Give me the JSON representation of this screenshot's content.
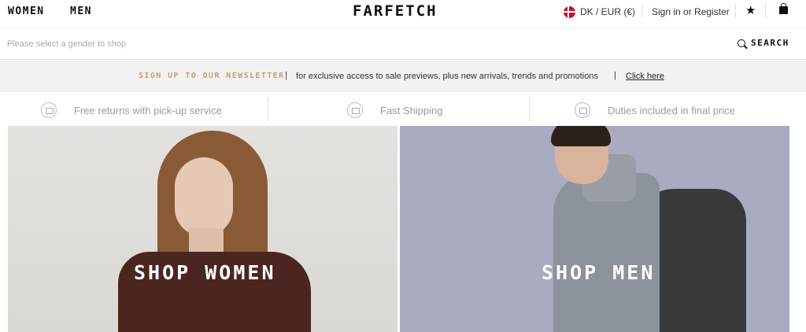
{
  "nav": {
    "women": "WOMEN",
    "men": "MEN",
    "logo": "FARFETCH",
    "locale": "DK / EUR (€)",
    "signin": "Sign in or Register",
    "wishlist_icon": "star-icon",
    "bag_icon": "bag-icon"
  },
  "search": {
    "placeholder": "Please select a gender to shop",
    "button": "SEARCH"
  },
  "newsletter": {
    "label": "SIGN UP TO OUR NEWSLETTER",
    "sep": "|",
    "text": "for exclusive access to sale previews, plus new arrivals, trends and promotions",
    "link": "Click here",
    "accent_color": "#c9a06d"
  },
  "features": [
    {
      "label": "Free returns with pick-up service",
      "icon": "return-icon"
    },
    {
      "label": "Fast Shipping",
      "icon": "shipping-icon"
    },
    {
      "label": "Duties included in final price",
      "icon": "card-icon"
    }
  ],
  "hero": {
    "women": "SHOP WOMEN",
    "men": "SHOP MEN"
  }
}
